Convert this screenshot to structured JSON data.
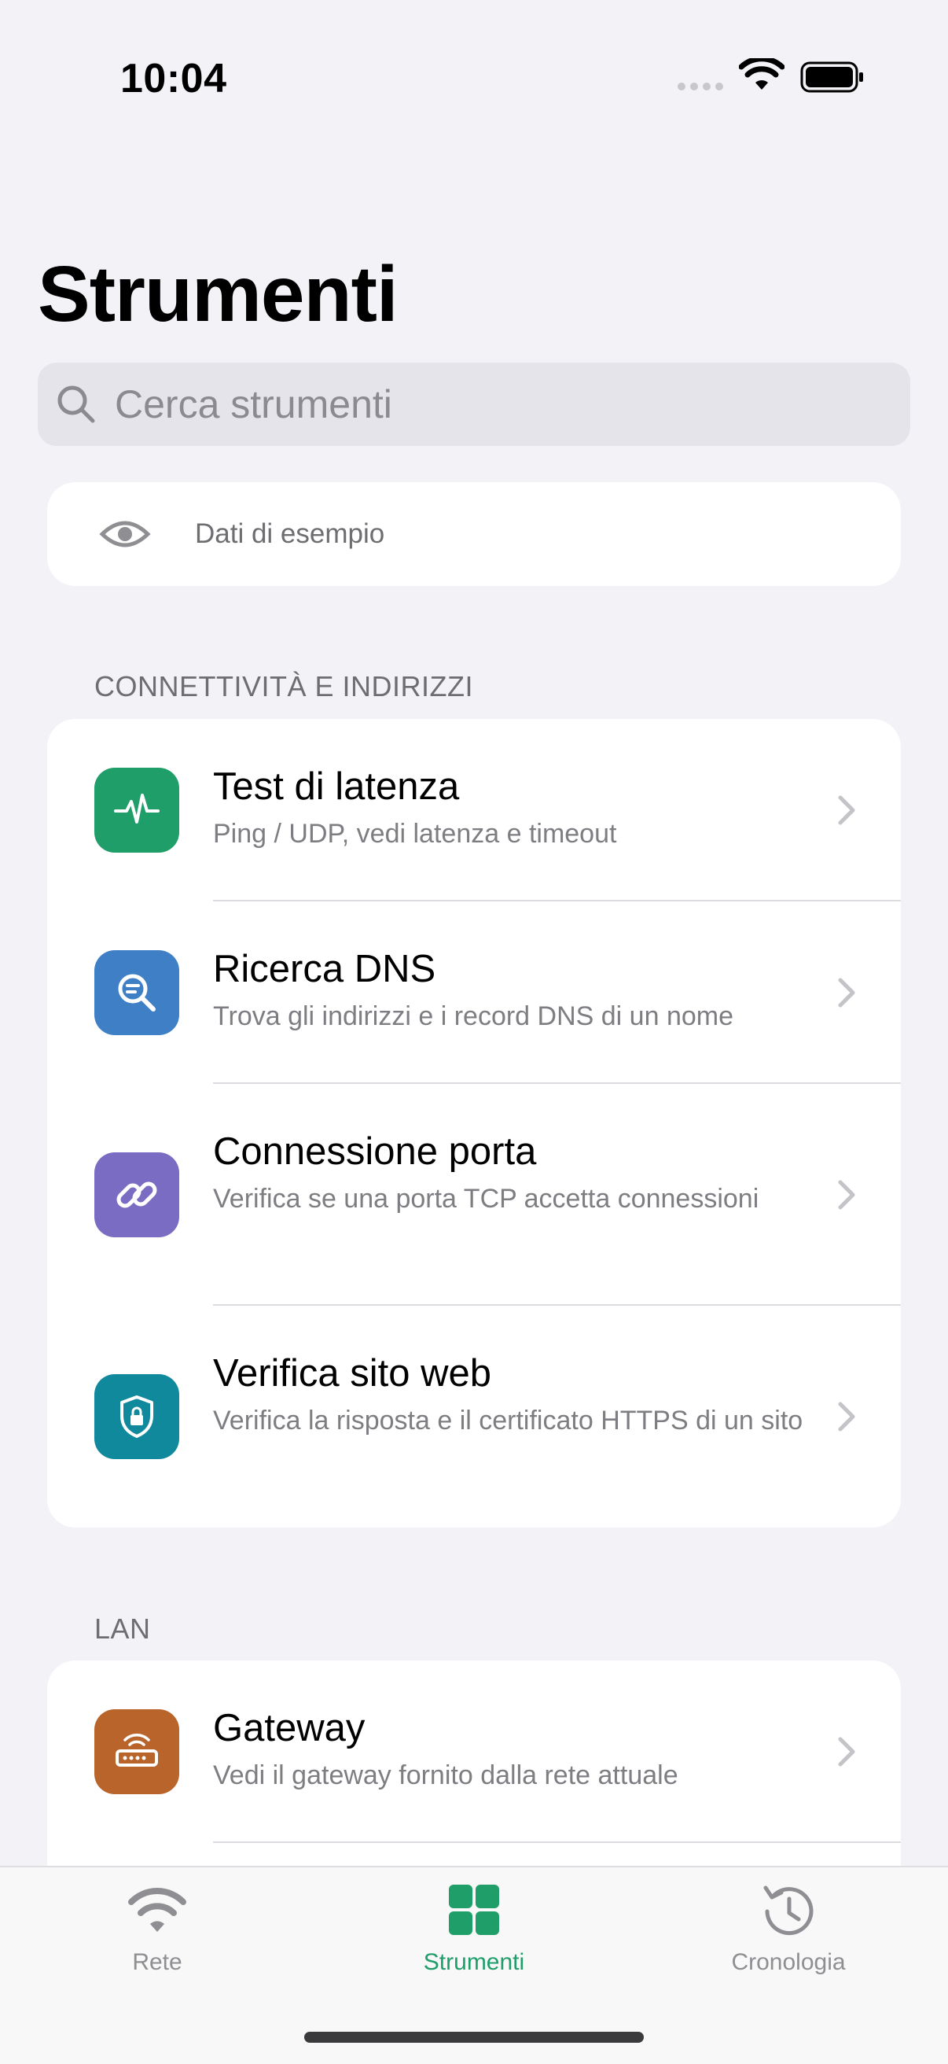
{
  "status_bar": {
    "time": "10:04"
  },
  "page_title": "Strumenti",
  "search": {
    "placeholder": "Cerca strumenti"
  },
  "sample_data": {
    "label": "Dati di esempio"
  },
  "sections": [
    {
      "header": "CONNETTIVITÀ E INDIRIZZI",
      "items": [
        {
          "title": "Test di latenza",
          "subtitle": "Ping / UDP, vedi latenza e timeout",
          "icon": "pulse-icon",
          "color": "#1f9e6a"
        },
        {
          "title": "Ricerca DNS",
          "subtitle": "Trova gli indirizzi e i record DNS di un nome",
          "icon": "magnifier-text-icon",
          "color": "#3f7fc6"
        },
        {
          "title": "Connessione porta",
          "subtitle": "Verifica se una porta TCP accetta connessioni",
          "icon": "link-icon",
          "color": "#7a6cc2"
        },
        {
          "title": "Verifica sito web",
          "subtitle": "Verifica la risposta e il certificato HTTPS di un sito",
          "icon": "shield-lock-icon",
          "color": "#11899c"
        }
      ]
    },
    {
      "header": "LAN",
      "items": [
        {
          "title": "Gateway",
          "subtitle": "Vedi il gateway fornito dalla rete attuale",
          "icon": "router-icon",
          "color": "#b8642a"
        }
      ]
    }
  ],
  "tabs": [
    {
      "label": "Rete",
      "icon": "wifi-icon",
      "active": false
    },
    {
      "label": "Strumenti",
      "icon": "grid-icon",
      "active": true
    },
    {
      "label": "Cronologia",
      "icon": "history-icon",
      "active": false
    }
  ],
  "colors": {
    "accent": "#1f9e6a",
    "inactive": "#8e8e93",
    "background": "#f2f2f7"
  }
}
